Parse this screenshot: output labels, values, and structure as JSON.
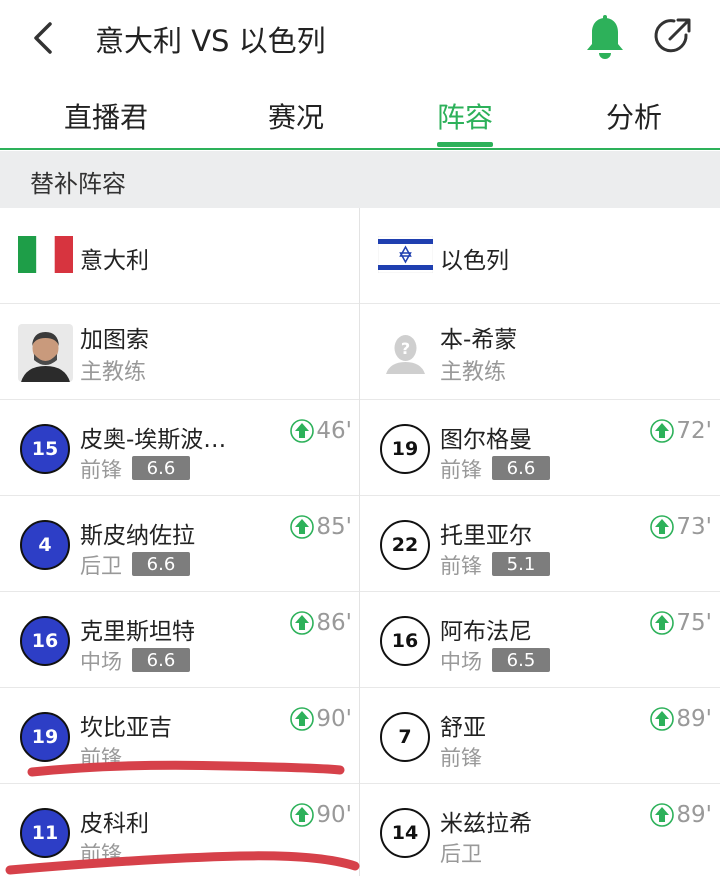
{
  "header": {
    "title": "意大利 VS 以色列",
    "icons": [
      "back-chevron-icon",
      "bell-icon",
      "share-icon"
    ],
    "accent_color": "#2db15a"
  },
  "tabs": [
    {
      "label": "直播君",
      "active": false
    },
    {
      "label": "赛况",
      "active": false
    },
    {
      "label": "阵容",
      "active": true
    },
    {
      "label": "分析",
      "active": false
    }
  ],
  "section": {
    "title": "替补阵容"
  },
  "teams": {
    "left": {
      "name": "意大利",
      "flag": "italy-flag-icon"
    },
    "right": {
      "name": "以色列",
      "flag": "israel-flag-icon"
    }
  },
  "coaches": {
    "left": {
      "name": "加图索",
      "role": "主教练"
    },
    "right": {
      "name": "本-希蒙",
      "role": "主教练"
    }
  },
  "subs": {
    "left": [
      {
        "number": "15",
        "name": "皮奥-埃斯波…",
        "position": "前锋",
        "rating": "6.6",
        "minute": "46'"
      },
      {
        "number": "4",
        "name": "斯皮纳佐拉",
        "position": "后卫",
        "rating": "6.6",
        "minute": "85'"
      },
      {
        "number": "16",
        "name": "克里斯坦特",
        "position": "中场",
        "rating": "6.6",
        "minute": "86'"
      },
      {
        "number": "19",
        "name": "坎比亚吉",
        "position": "前锋",
        "rating": "",
        "minute": "90'"
      },
      {
        "number": "11",
        "name": "皮科利",
        "position": "前锋",
        "rating": "",
        "minute": "90'"
      }
    ],
    "right": [
      {
        "number": "19",
        "name": "图尔格曼",
        "position": "前锋",
        "rating": "6.6",
        "minute": "72'"
      },
      {
        "number": "22",
        "name": "托里亚尔",
        "position": "前锋",
        "rating": "5.1",
        "minute": "73'"
      },
      {
        "number": "16",
        "name": "阿布法尼",
        "position": "中场",
        "rating": "6.5",
        "minute": "75'"
      },
      {
        "number": "7",
        "name": "舒亚",
        "position": "前锋",
        "rating": "",
        "minute": "89'"
      },
      {
        "number": "14",
        "name": "米兹拉希",
        "position": "后卫",
        "rating": "",
        "minute": "89'"
      }
    ]
  },
  "colors": {
    "italy_kit": "#2d3ec6",
    "israel_kit": "#ffffff",
    "annotation": "#d6414a"
  }
}
